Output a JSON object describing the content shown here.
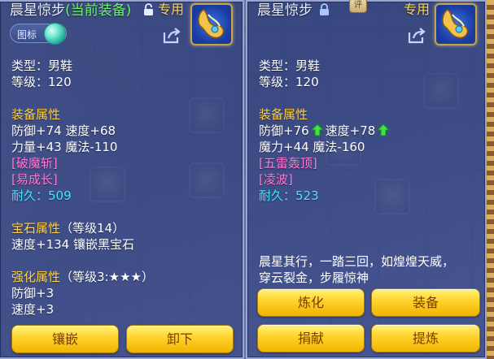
{
  "left_panel": {
    "title_name": "晨星惊步",
    "title_current": "(当前装备)",
    "exclusive": "专用",
    "tag_label": "图标",
    "type": "类型：男鞋",
    "level": "等级：120",
    "attr_header": "装备属性",
    "attr_line1": "防御+74  速度+68",
    "attr_line2": "力量+43  魔法-110",
    "skill1": "[破魔斩]",
    "skill2": "[易成长]",
    "durability_label": "耐久：",
    "durability_value": "509",
    "gem_header": "宝石属性",
    "gem_level": "（等级14）",
    "gem_line": "速度+134  镶嵌黑宝石",
    "enhance_header": "强化属性",
    "enhance_level": "（等级3:",
    "enhance_stars": "★★★",
    "enhance_close": "）",
    "enhance_line1": "防御+3",
    "enhance_line2": "速度+3",
    "buttons": {
      "inlay": "镶嵌",
      "unequip": "卸下"
    }
  },
  "right_panel": {
    "title_name": "晨星惊步",
    "exclusive": "专用",
    "seal_label": "评",
    "type": "类型：男鞋",
    "level": "等级：120",
    "attr_header": "装备属性",
    "defense": "防御+76",
    "speed": "速度+78",
    "attr_line2": "魔力+44  魔法-160",
    "skill1": "[五雷轰顶]",
    "skill2": "[凌波]",
    "durability_label": "耐久：",
    "durability_value": "523",
    "description_line1": "晨星其行，一踏三回，如煌煌天威，",
    "description_line2": "穿云裂金，步履惊神",
    "buttons": {
      "refine": "炼化",
      "equip": "装备",
      "donate": "捐献",
      "extract": "提炼"
    }
  },
  "icons": {
    "lock": "lock-icon",
    "share": "share-icon",
    "item": "boots-item-icon",
    "orb": "orb-icon",
    "up": "up-arrow-icon"
  },
  "colors": {
    "current_equip": "#6cf36a",
    "section_header": "#ffd24a",
    "skill": "#ff7ad6",
    "durability": "#44e6ff",
    "button_gold": "#ffd22a"
  }
}
